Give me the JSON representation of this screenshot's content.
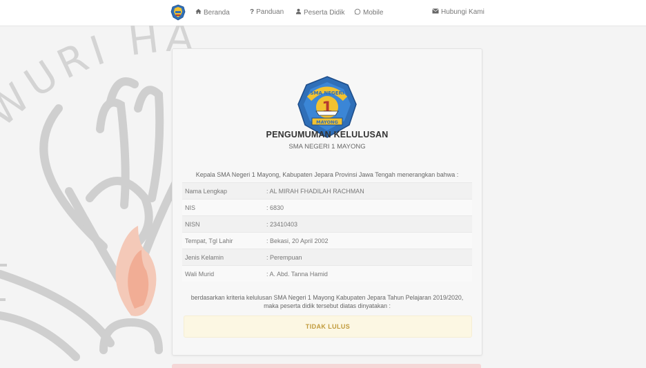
{
  "nav": {
    "items": [
      {
        "label": "Beranda",
        "icon": "home-icon"
      },
      {
        "label": "Panduan",
        "icon": "question-icon"
      },
      {
        "label": "Peserta Didik",
        "icon": "user-icon"
      },
      {
        "label": "Mobile",
        "icon": "whatsapp-icon"
      },
      {
        "label": "Hubungi Kami",
        "icon": "envelope-icon"
      }
    ]
  },
  "watermark": {
    "text": "WURI HA"
  },
  "card": {
    "logo_text": {
      "top": "SMA NEGERI",
      "bottom": "MAYONG",
      "number": "1"
    },
    "title": "PENGUMUMAN KELULUSAN",
    "subtitle": "SMA NEGERI 1 MAYONG",
    "intro": "Kepala SMA Negeri 1 Mayong, Kabupaten Jepara Provinsi Jawa Tengah menerangkan bahwa :",
    "rows": [
      {
        "label": "Nama Lengkap",
        "value": ": AL MIRAH FHADILAH RACHMAN"
      },
      {
        "label": "NIS",
        "value": ": 6830"
      },
      {
        "label": "NISN",
        "value": ": 23410403"
      },
      {
        "label": "Tempat, Tgl Lahir",
        "value": ": Bekasi, 20 April 2002"
      },
      {
        "label": "Jenis Kelamin",
        "value": ": Perempuan"
      },
      {
        "label": "Wali Murid",
        "value": ": A. Abd. Tanna Hamid"
      }
    ],
    "criteria_line1": "berdasarkan kriteria kelulusan SMA Negeri 1 Mayong Kabupaten Jepara Tahun Pelajaran 2019/2020,",
    "criteria_line2": "maka peserta didik tersebut diatas dinyatakan :",
    "result": "TIDAK LULUS"
  },
  "colors": {
    "result_bg": "#fcf7e3",
    "result_text": "#c09a3a",
    "logo_blue": "#2f6fb8",
    "logo_yellow": "#f2c230"
  }
}
